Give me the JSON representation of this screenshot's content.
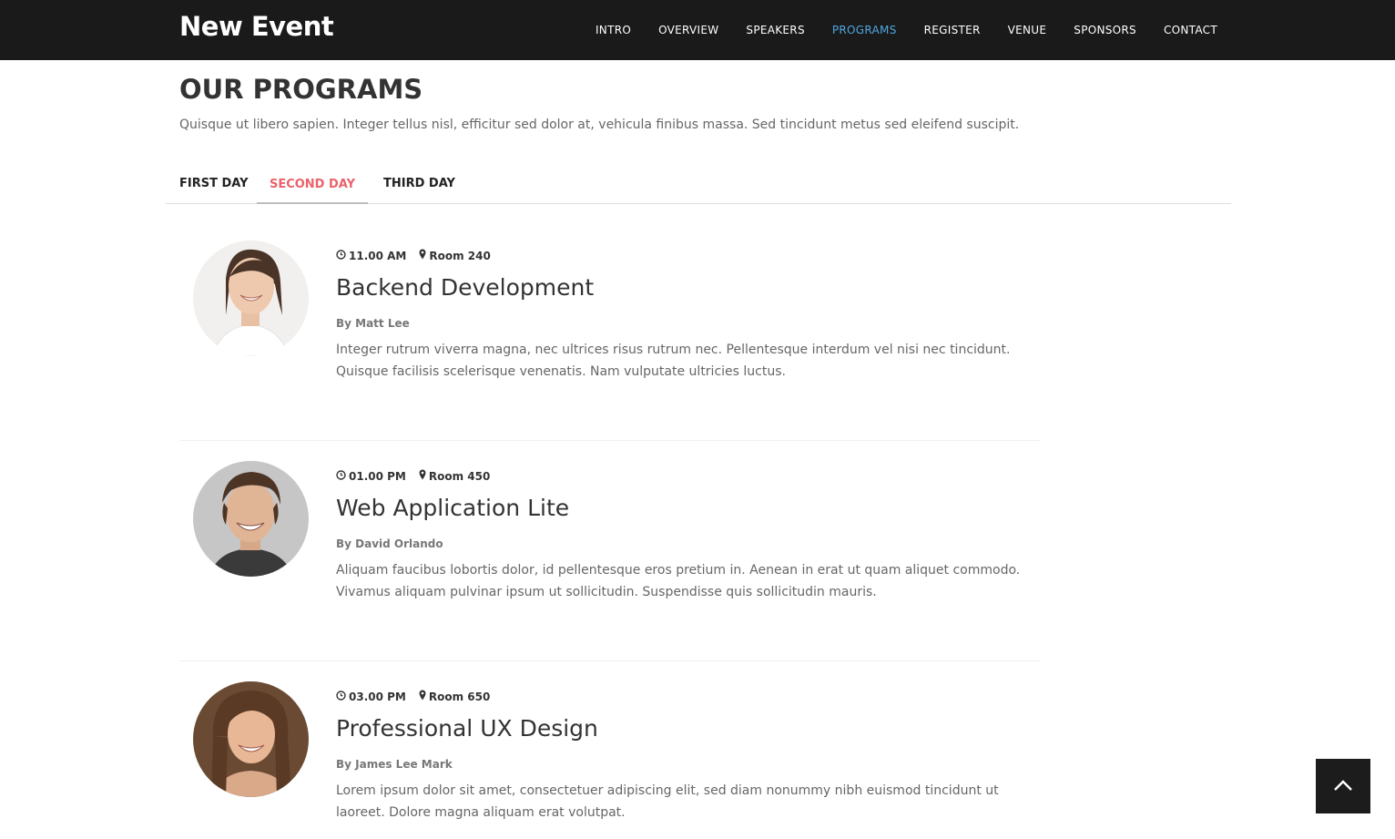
{
  "header": {
    "brand": "New Event",
    "nav": [
      "INTRO",
      "OVERVIEW",
      "SPEAKERS",
      "PROGRAMS",
      "REGISTER",
      "VENUE",
      "SPONSORS",
      "CONTACT"
    ],
    "active_nav": "PROGRAMS"
  },
  "section": {
    "title": "OUR PROGRAMS",
    "subtitle": "Quisque ut libero sapien. Integer tellus nisl, efficitur sed dolor at, vehicula finibus massa. Sed tincidunt metus sed eleifend suscipit."
  },
  "tabs": [
    {
      "label": "FIRST DAY",
      "active": false
    },
    {
      "label": "SECOND DAY",
      "active": true
    },
    {
      "label": "THIRD DAY",
      "active": false
    }
  ],
  "programs": [
    {
      "time": "11.00 AM",
      "room": "Room 240",
      "title": "Backend Development",
      "by": "By Matt Lee",
      "description": "Integer rutrum viverra magna, nec ultrices risus rutrum nec. Pellentesque interdum vel nisi nec tincidunt. Quisque facilisis scelerisque venenatis. Nam vulputate ultricies luctus."
    },
    {
      "time": "01.00 PM",
      "room": "Room 450",
      "title": "Web Application Lite",
      "by": "By David Orlando",
      "description": "Aliquam faucibus lobortis dolor, id pellentesque eros pretium in. Aenean in erat ut quam aliquet commodo. Vivamus aliquam pulvinar ipsum ut sollicitudin. Suspendisse quis sollicitudin mauris."
    },
    {
      "time": "03.00 PM",
      "room": "Room 650",
      "title": "Professional UX Design",
      "by": "By James Lee Mark",
      "description": "Lorem ipsum dolor sit amet, consectetuer adipiscing elit, sed diam nonummy nibh euismod tincidunt ut laoreet. Dolore magna aliquam erat volutpat."
    }
  ],
  "icons": {
    "time": "clock-icon",
    "room": "map-marker-icon",
    "back_to_top": "chevron-up-icon"
  },
  "colors": {
    "topbar": "#1a1a1a",
    "nav_active": "#4fa8e0",
    "tab_active": "#e9636b"
  }
}
